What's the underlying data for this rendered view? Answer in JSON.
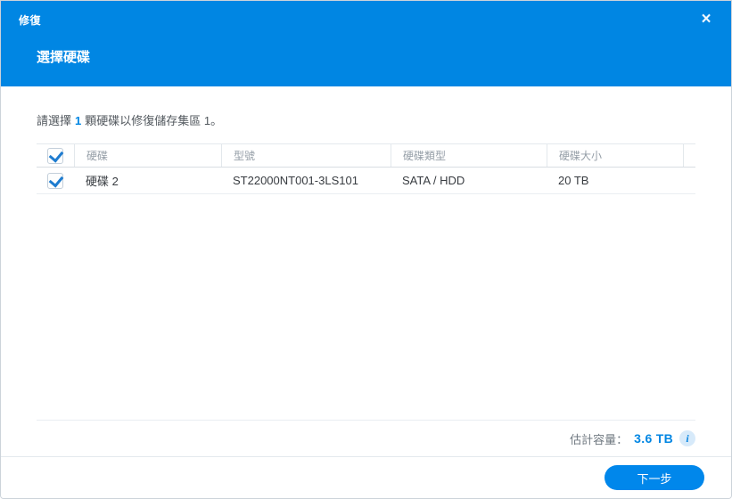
{
  "window": {
    "title": "修復",
    "close_icon": "×"
  },
  "panel": {
    "title": "選擇硬碟"
  },
  "instruction": {
    "text_before": "請選擇",
    "highlight_count": "1",
    "text_after": "顆硬碟以修復儲存集區 1。"
  },
  "table": {
    "select_all_checked": true,
    "columns": [
      {
        "label": "硬碟"
      },
      {
        "label": "型號"
      },
      {
        "label": "硬碟類型"
      },
      {
        "label": "硬碟大小"
      }
    ],
    "rows": [
      {
        "checked": true,
        "disk": "硬碟 2",
        "model": "ST22000NT001-3LS101",
        "type": "SATA / HDD",
        "size": "20 TB"
      }
    ]
  },
  "summary": {
    "capacity_label": "估計容量：",
    "capacity_value": "3.6 TB",
    "info_icon": "i"
  },
  "footer": {
    "next_button": "下一步"
  },
  "colors": {
    "header_blue": "#0086e3",
    "button_blue": "#0087eb",
    "accent_text_blue": "#0086e3",
    "checkmark_blue": "#1e7cd0"
  }
}
